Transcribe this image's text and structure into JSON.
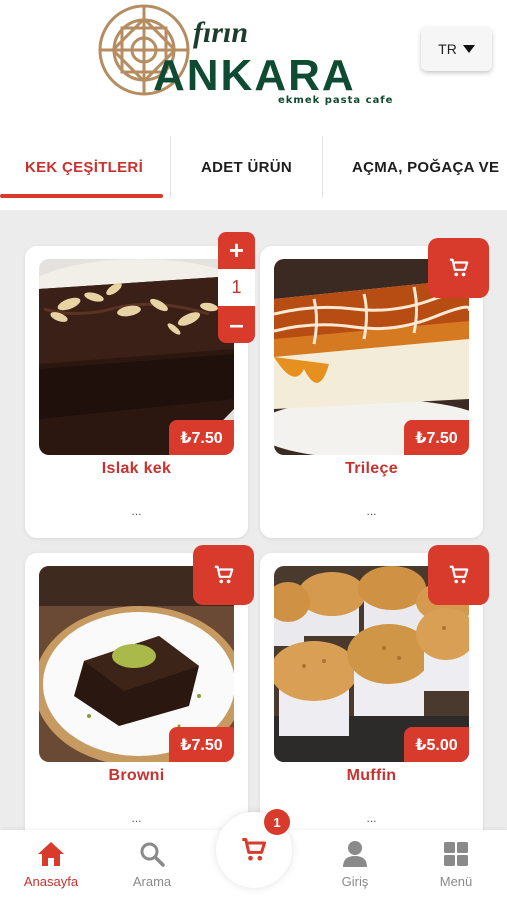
{
  "brand": {
    "logo_small": "fırın",
    "logo_main": "ANKARA",
    "logo_tagline": "ekmek  pasta  cafe"
  },
  "language": {
    "label": "TR"
  },
  "tabs": [
    {
      "label": "KEK ÇEŞİTLERİ",
      "active": true
    },
    {
      "label": "ADET ÜRÜN",
      "active": false
    },
    {
      "label": "AÇMA, POĞAÇA VE",
      "active": false
    }
  ],
  "products": [
    {
      "name": "Islak kek",
      "price": "₺7.50",
      "desc": "...",
      "quantity": "1"
    },
    {
      "name": "Trileçe",
      "price": "₺7.50",
      "desc": "..."
    },
    {
      "name": "Browni",
      "price": "₺7.50",
      "desc": "..."
    },
    {
      "name": "Muffin",
      "price": "₺5.00",
      "desc": "..."
    }
  ],
  "nav": {
    "home": "Anasayfa",
    "search": "Arama",
    "login": "Giriş",
    "menu": "Menü",
    "cart_count": "1"
  },
  "colors": {
    "accent": "#d83a2c",
    "brand_green": "#0f4a32",
    "logo_tan": "#b58d61"
  }
}
